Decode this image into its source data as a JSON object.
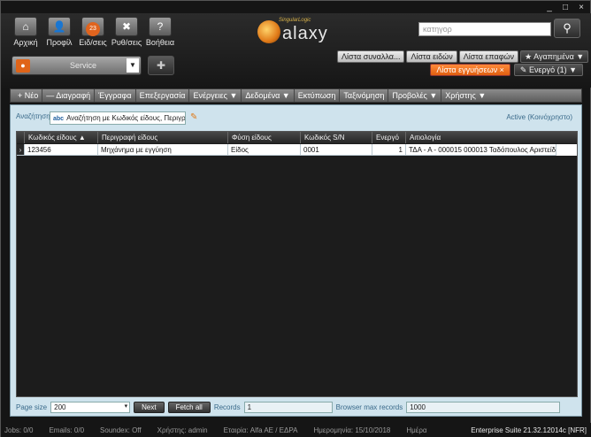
{
  "window": {
    "controls": [
      "_",
      "□",
      "×"
    ]
  },
  "topbar": {
    "buttons": [
      {
        "label": "Αρχική",
        "icon": "home-icon",
        "glyph": "⌂"
      },
      {
        "label": "Προφίλ",
        "icon": "profile-icon",
        "glyph": "👤"
      },
      {
        "label": "Ειδ/σεις",
        "icon": "notifications-icon",
        "badge": "23"
      },
      {
        "label": "Ρυθ/σεις",
        "icon": "settings-tools-icon",
        "glyph": "✖"
      },
      {
        "label": "Βοήθεια",
        "icon": "help-icon",
        "glyph": "?"
      }
    ],
    "logo_small": "SingularLogic",
    "logo_text": "alaxy",
    "search_placeholder": "κατηγορ",
    "search_glyph": "⚲",
    "service_label": "Service",
    "service_dropdown": "▼",
    "puzzle_glyph": "✚"
  },
  "quick_tabs": [
    "Λίστα συναλλα...",
    "Λίστα ειδών",
    "Λίστα επαφών",
    "★ Αγαπημένα ▼"
  ],
  "open_tab": {
    "label": "Λίστα εγγυήσεων",
    "close": "×"
  },
  "active_tab": {
    "label": "✎ Ενεργό (1) ▼"
  },
  "menubar": [
    "+  Νέο",
    "—  Διαγραφή",
    "Έγγραφα",
    "Επεξεργασία",
    "Ενέργειες ▼",
    "Δεδομένα ▼",
    "Εκτύπωση",
    "Ταξινόμηση",
    "Προβολές ▼",
    "Χρήστης ▼"
  ],
  "filter": {
    "label": "Αναζήτηση",
    "abc": "abc",
    "value": "Αναζήτηση με Κωδικός είδους, Περιγραφή",
    "active_label": "Active (Κοινόχρηστο)"
  },
  "grid": {
    "columns": [
      "Κωδικός είδους  ▲",
      "Περιγραφή είδους",
      "Φύση είδους",
      "Κωδικός S/N",
      "Ενεργό",
      "Αιτιολογία"
    ],
    "rows": [
      [
        "123456",
        "Μηχάνημα με εγγύηση",
        "Είδος",
        "0001",
        "1",
        "ΤΔΑ - Α - 000015 000013 Ταδόπουλος Αριστείδης"
      ]
    ]
  },
  "footer": {
    "page_size_label": "Page size",
    "page_size_value": "200",
    "next_label": "Next",
    "fetch_all_label": "Fetch all",
    "records_label": "Records",
    "records_value": "1",
    "browser_max_label": "Browser max records",
    "browser_max_value": "1000"
  },
  "statusbar": {
    "jobs": "Jobs: 0/0",
    "emails": "Emails: 0/0",
    "soundex": "Soundex: Off",
    "user": "Χρήστης: admin",
    "company": "Εταιρία: Alfa AE / ΕΔΡΑ",
    "date": "Ημερομηνία: 15/10/2018",
    "period": "Ημέρα",
    "version": "Enterprise Suite  21.32.12014c [NFR]"
  }
}
